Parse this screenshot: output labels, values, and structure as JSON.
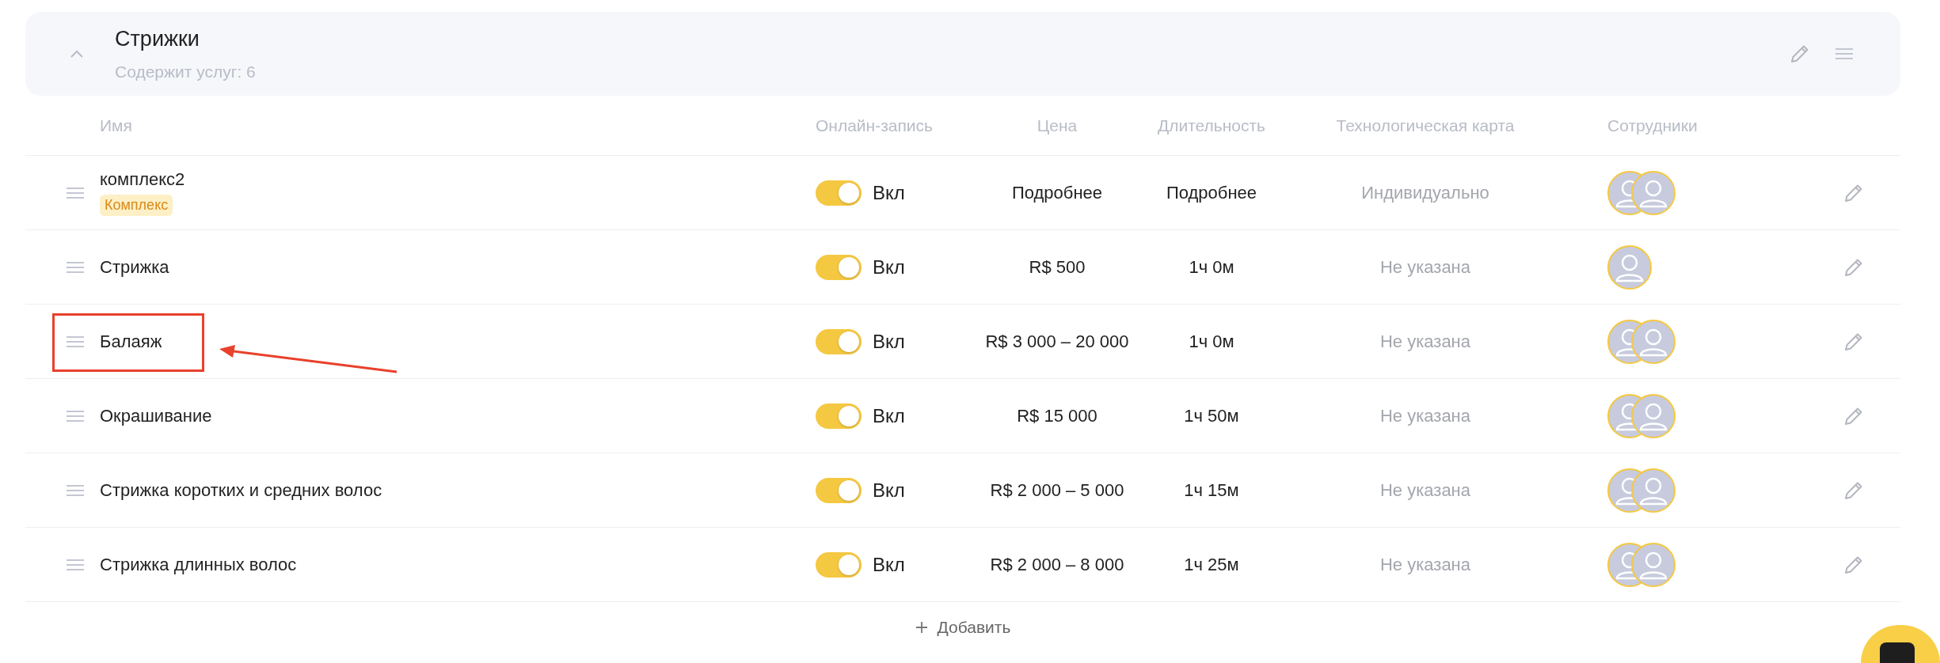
{
  "group": {
    "title": "Стрижки",
    "subtitle": "Содержит услуг: 6",
    "expanded": true
  },
  "columns": [
    "Имя",
    "Онлайн-запись",
    "Цена",
    "Длительность",
    "Технологическая карта",
    "Сотрудники"
  ],
  "rows": [
    {
      "name": "комплекс2",
      "badge": "Комплекс",
      "online": {
        "on": true,
        "label": "Вкл"
      },
      "price": "Подробнее",
      "duration": "Подробнее",
      "tech_card": "Индивидуально",
      "staff": [
        {
          "kind": "placeholder"
        },
        {
          "kind": "placeholder"
        }
      ],
      "highlighted": false
    },
    {
      "name": "Стрижка",
      "online": {
        "on": true,
        "label": "Вкл"
      },
      "price": "R$ 500",
      "duration": "1ч 0м",
      "tech_card": "Не указана",
      "staff": [
        {
          "kind": "placeholder"
        }
      ],
      "highlighted": false
    },
    {
      "name": "Балаяж",
      "online": {
        "on": true,
        "label": "Вкл"
      },
      "price": "R$ 3 000 – 20 000",
      "duration": "1ч 0м",
      "tech_card": "Не указана",
      "staff": [
        {
          "kind": "placeholder"
        },
        {
          "kind": "placeholder"
        }
      ],
      "highlighted": true
    },
    {
      "name": "Окрашивание",
      "online": {
        "on": true,
        "label": "Вкл"
      },
      "price": "R$ 15 000",
      "duration": "1ч 50м",
      "tech_card": "Не указана",
      "staff": [
        {
          "kind": "placeholder"
        },
        {
          "kind": "placeholder"
        }
      ],
      "highlighted": false
    },
    {
      "name": "Стрижка коротких и средних волос",
      "online": {
        "on": true,
        "label": "Вкл"
      },
      "price": "R$ 2 000 – 5 000",
      "duration": "1ч 15м",
      "tech_card": "Не указана",
      "staff": [
        {
          "kind": "placeholder"
        },
        {
          "kind": "placeholder"
        }
      ],
      "highlighted": false
    },
    {
      "name": "Стрижка длинных волос",
      "online": {
        "on": true,
        "label": "Вкл"
      },
      "price": "R$ 2 000 – 8 000",
      "duration": "1ч 25м",
      "tech_card": "Не указана",
      "staff": [
        {
          "kind": "placeholder"
        },
        {
          "kind": "placeholder"
        }
      ],
      "highlighted": false
    }
  ],
  "add_button": {
    "label": "Добавить"
  }
}
